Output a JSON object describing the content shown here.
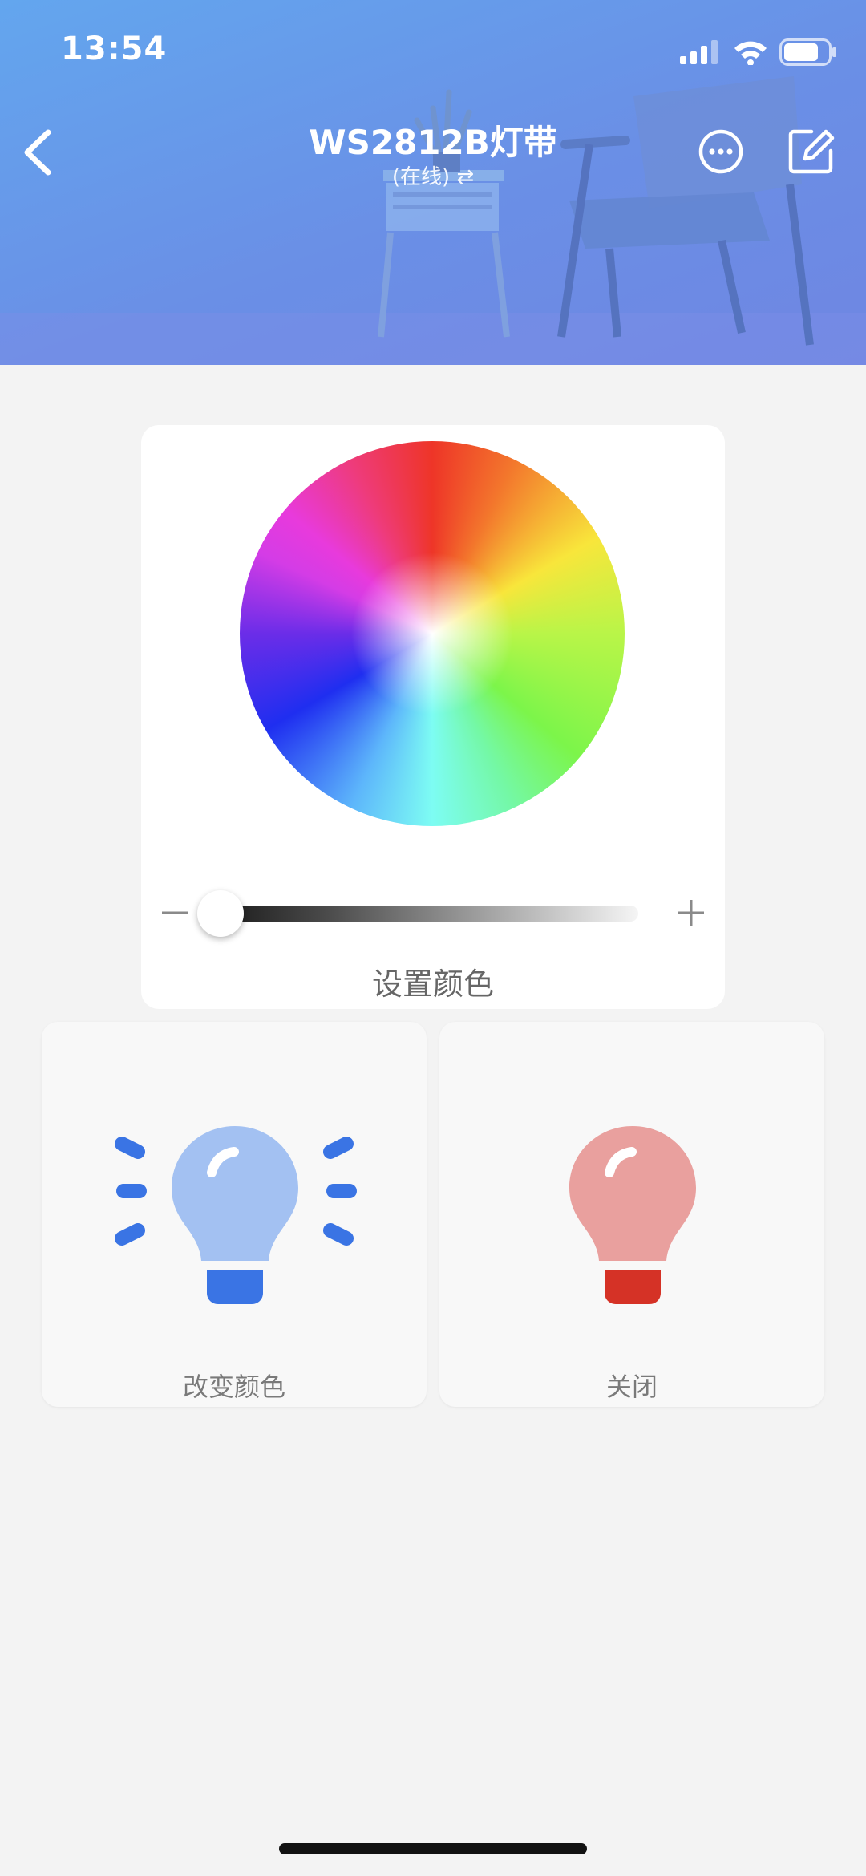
{
  "status_bar": {
    "time": "13:54"
  },
  "header": {
    "title": "WS2812B灯带",
    "subtitle": "(在线) ⇄"
  },
  "color_card": {
    "label": "设置颜色",
    "brightness": 0.0
  },
  "actions": [
    {
      "label": "改变颜色",
      "icon": "bulb-on-icon",
      "color": "#3a74e4",
      "bulb_color": "#a3c1f2"
    },
    {
      "label": "关闭",
      "icon": "bulb-off-icon",
      "color": "#d53226",
      "bulb_color": "#e9a09e"
    }
  ],
  "colors": {
    "header_bg": "#6a8fe6",
    "page_bg": "#f3f3f3"
  }
}
